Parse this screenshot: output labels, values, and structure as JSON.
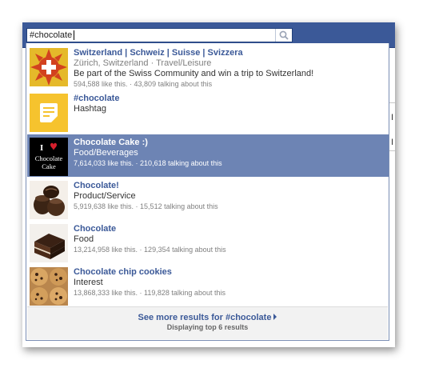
{
  "search": {
    "value": "#chocolate",
    "icon": "search-icon"
  },
  "results": [
    {
      "title": "Switzerland | Schweiz | Suisse | Svizzera",
      "subtitle": "Zürich, Switzerland · Travel/Leisure",
      "description": "Be part of the Swiss Community and win a trip to Switzerland!",
      "stats": "594,588 like this. · 43,809 talking about this",
      "thumb": "swiss-cross-sun-logo"
    },
    {
      "title": "#chocolate",
      "subtitle": "Hashtag",
      "thumb": "hashtag-note-icon"
    },
    {
      "title": "Chocolate Cake :)",
      "subtitle": "Food/Beverages",
      "stats": "7,614,033 like this. · 210,618 talking about this",
      "thumb_text": [
        "I",
        "Chocolate",
        "Cake"
      ],
      "selected": true
    },
    {
      "title": "Chocolate!",
      "subtitle": "Product/Service",
      "stats": "5,919,638 like this. · 15,512 talking about this",
      "thumb": "chocolate-truffles-photo"
    },
    {
      "title": "Chocolate",
      "subtitle": "Food",
      "stats": "13,214,958 like this. · 129,354 talking about this",
      "thumb": "chocolate-cake-slice-photo"
    },
    {
      "title": "Chocolate chip cookies",
      "subtitle": "Interest",
      "stats": "13,868,333 like this. · 119,828 talking about this",
      "thumb": "cookies-photo"
    }
  ],
  "footer": {
    "see_more": "See more results for #chocolate",
    "displaying": "Displaying top 6 results"
  },
  "background": {
    "side_glyph_1": "I",
    "side_glyph_2": "I"
  },
  "colors": {
    "brand_blue": "#3b5998",
    "selected_bg": "#6d84b4",
    "link": "#3b5998"
  }
}
